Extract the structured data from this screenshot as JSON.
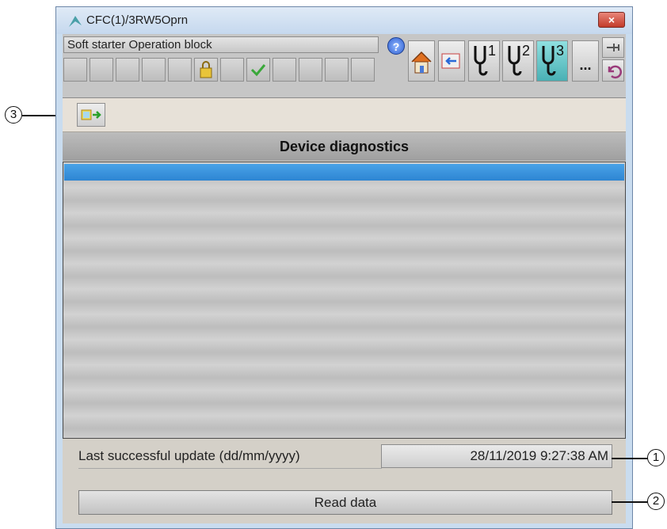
{
  "window": {
    "title": "CFC(1)/3RW5Oprn",
    "close_label": "×"
  },
  "toolbar": {
    "block_name": "Soft starter Operation block",
    "help_label": "?",
    "more_label": "...",
    "loop_labels": [
      "1",
      "2",
      "3"
    ]
  },
  "diagnostics": {
    "header": "Device diagnostics",
    "last_update_label": "Last successful update (dd/mm/yyyy)",
    "last_update_value": "28/11/2019  9:27:38 AM",
    "read_button": "Read data"
  },
  "callouts": [
    "1",
    "2",
    "3"
  ],
  "colors": {
    "selected_row": "#3b93dd",
    "frame": "#c9dcef",
    "close": "#d9534f"
  }
}
